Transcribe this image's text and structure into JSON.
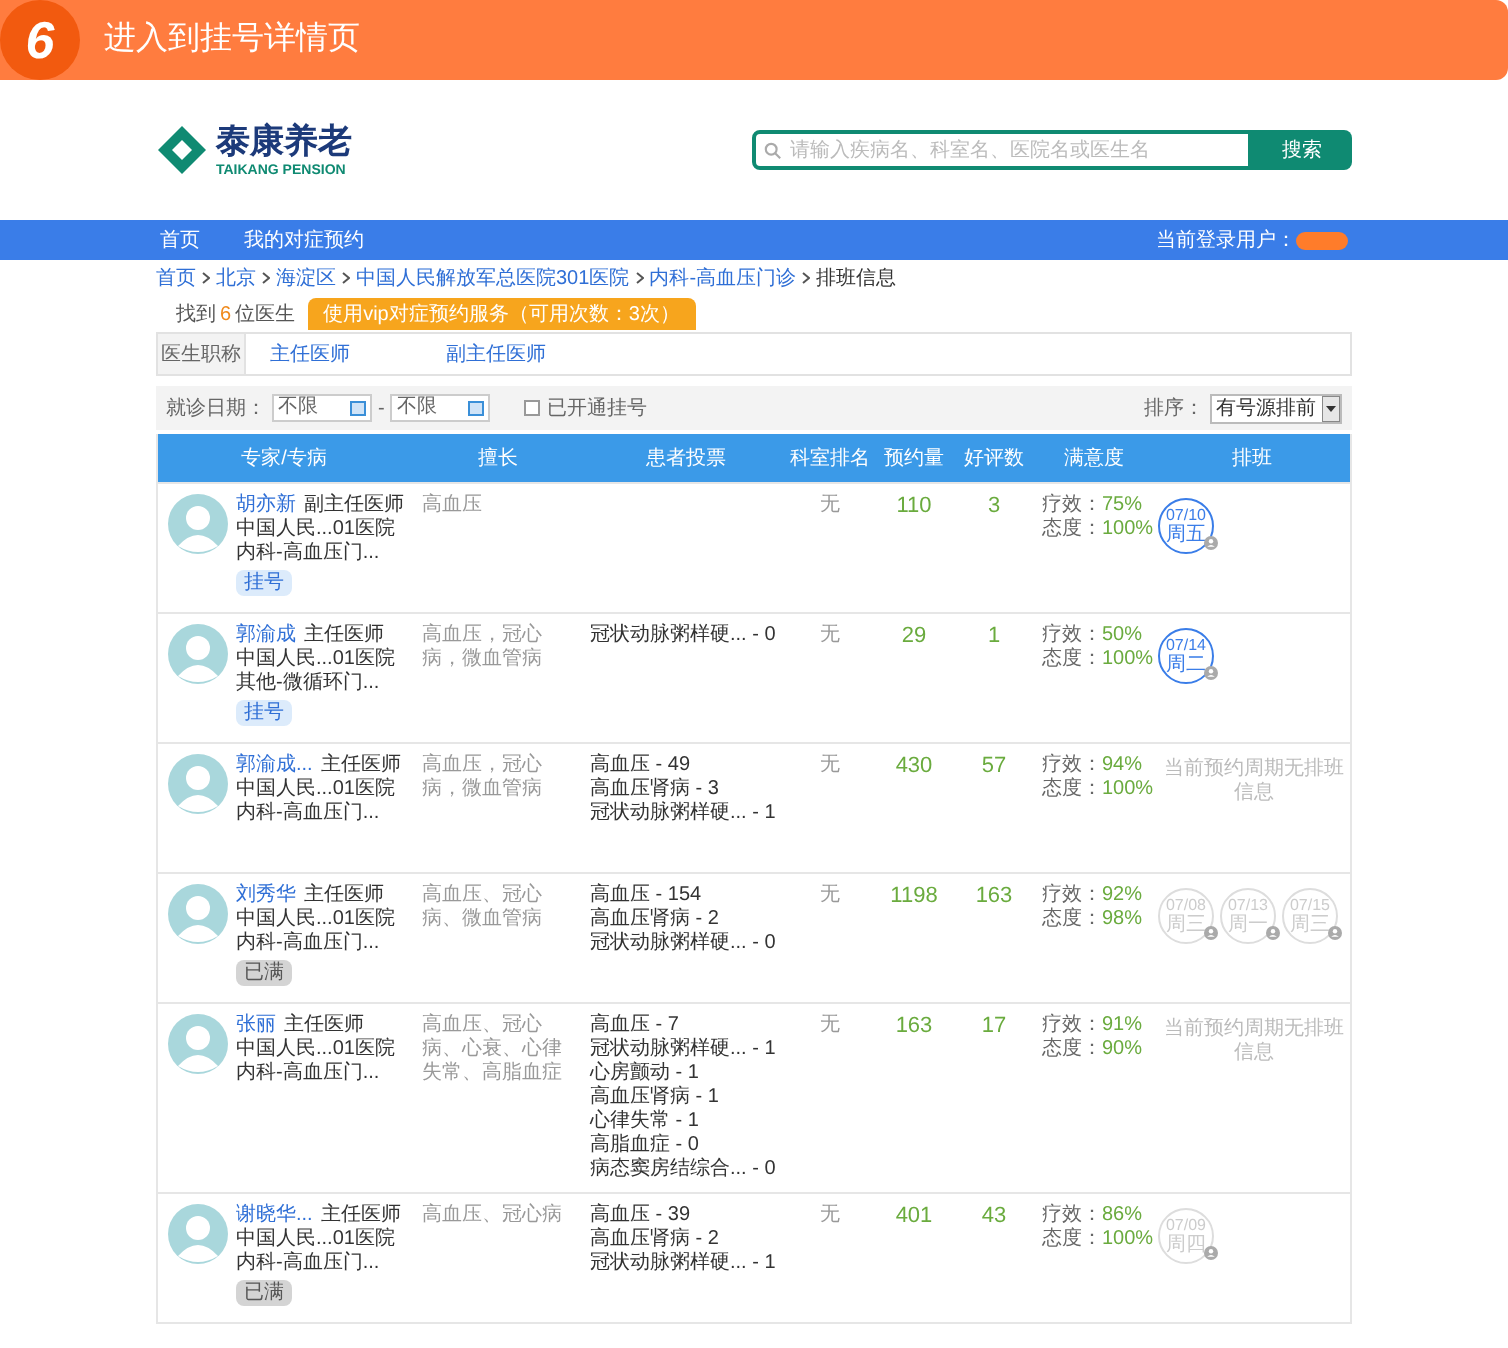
{
  "banner": {
    "step": "6",
    "title": "进入到挂号详情页"
  },
  "logo": {
    "name": "泰康养老",
    "subtitle": "TAIKANG PENSION"
  },
  "search": {
    "placeholder": "请输入疾病名、科室名、医院名或医生名",
    "button": "搜索"
  },
  "nav": {
    "items": [
      "首页",
      "我的对症预约"
    ],
    "user_label": "当前登录用户："
  },
  "breadcrumb": [
    "首页",
    "北京",
    "海淀区",
    "中国人民解放军总医院301医院",
    "内科-高血压门诊",
    "排班信息"
  ],
  "result": {
    "prefix": "找到",
    "count": "6",
    "suffix": "位医生",
    "vip_button": "使用vip对症预约服务（可用次数：3次）"
  },
  "title_filter": {
    "label": "医生职称",
    "options": [
      "主任医师",
      "副主任医师"
    ]
  },
  "date_filter": {
    "label": "就诊日期：",
    "from": "不限",
    "separator": "-",
    "to": "不限",
    "open_only": {
      "label": "已开通挂号",
      "checked": false
    },
    "sort_label": "排序：",
    "sort_value": "有号源排前"
  },
  "table": {
    "columns": [
      "专家/专病",
      "擅长",
      "患者投票",
      "科室排名",
      "预约量",
      "好评数",
      "满意度",
      "排班"
    ],
    "rows": [
      {
        "name": "胡亦新",
        "title": "副主任医师",
        "hospital": "中国人民...01医院",
        "dept": "内科-高血压门...",
        "button": {
          "label": "挂号",
          "disabled": false
        },
        "specialty": "高血压",
        "votes": [],
        "rank": "无",
        "bookings": "110",
        "reviews": "3",
        "satisfaction": [
          {
            "label": "疗效：",
            "value": "75%"
          },
          {
            "label": "态度：",
            "value": "100%"
          }
        ],
        "slots": [
          {
            "date": "07/10",
            "weekday": "周五",
            "available": true
          }
        ]
      },
      {
        "name": "郭渝成",
        "title": "主任医师",
        "hospital": "中国人民...01医院",
        "dept": "其他-微循环门...",
        "button": {
          "label": "挂号",
          "disabled": false
        },
        "specialty": "高血压，冠心病，微血管病",
        "votes": [
          "冠状动脉粥样硬... - 0"
        ],
        "rank": "无",
        "bookings": "29",
        "reviews": "1",
        "satisfaction": [
          {
            "label": "疗效：",
            "value": "50%"
          },
          {
            "label": "态度：",
            "value": "100%"
          }
        ],
        "slots": [
          {
            "date": "07/14",
            "weekday": "周二",
            "available": true
          }
        ]
      },
      {
        "name": "郭渝成...",
        "title": "主任医师",
        "hospital": "中国人民...01医院",
        "dept": "内科-高血压门...",
        "specialty": "高血压，冠心病，微血管病",
        "votes": [
          "高血压 - 49",
          "高血压肾病 - 3",
          "冠状动脉粥样硬... - 1"
        ],
        "rank": "无",
        "bookings": "430",
        "reviews": "57",
        "satisfaction": [
          {
            "label": "疗效：",
            "value": "94%"
          },
          {
            "label": "态度：",
            "value": "100%"
          }
        ],
        "no_schedule": "当前预约周期无排班信息"
      },
      {
        "name": "刘秀华",
        "title": "主任医师",
        "hospital": "中国人民...01医院",
        "dept": "内科-高血压门...",
        "button": {
          "label": "已满",
          "disabled": true
        },
        "specialty": "高血压、冠心病、微血管病",
        "votes": [
          "高血压 - 154",
          "高血压肾病 - 2",
          "冠状动脉粥样硬... - 0"
        ],
        "rank": "无",
        "bookings": "1198",
        "reviews": "163",
        "satisfaction": [
          {
            "label": "疗效：",
            "value": "92%"
          },
          {
            "label": "态度：",
            "value": "98%"
          }
        ],
        "slots": [
          {
            "date": "07/08",
            "weekday": "周三",
            "available": false
          },
          {
            "date": "07/13",
            "weekday": "周一",
            "available": false
          },
          {
            "date": "07/15",
            "weekday": "周三",
            "available": false
          }
        ]
      },
      {
        "name": "张丽",
        "title": "主任医师",
        "hospital": "中国人民...01医院",
        "dept": "内科-高血压门...",
        "specialty": "高血压、冠心病、心衰、心律失常、高脂血症",
        "votes": [
          "高血压 - 7",
          "冠状动脉粥样硬... - 1",
          "心房颤动 - 1",
          "高血压肾病 - 1",
          "心律失常 - 1",
          "高脂血症 - 0",
          "病态窦房结综合... - 0"
        ],
        "rank": "无",
        "bookings": "163",
        "reviews": "17",
        "satisfaction": [
          {
            "label": "疗效：",
            "value": "91%"
          },
          {
            "label": "态度：",
            "value": "90%"
          }
        ],
        "no_schedule": "当前预约周期无排班信息"
      },
      {
        "name": "谢晓华...",
        "title": "主任医师",
        "hospital": "中国人民...01医院",
        "dept": "内科-高血压门...",
        "button": {
          "label": "已满",
          "disabled": true
        },
        "specialty": "高血压、冠心病",
        "votes": [
          "高血压 - 39",
          "高血压肾病 - 2",
          "冠状动脉粥样硬... - 1"
        ],
        "rank": "无",
        "bookings": "401",
        "reviews": "43",
        "satisfaction": [
          {
            "label": "疗效：",
            "value": "86%"
          },
          {
            "label": "态度：",
            "value": "100%"
          }
        ],
        "slots": [
          {
            "date": "07/09",
            "weekday": "周四",
            "available": false
          }
        ]
      }
    ]
  }
}
